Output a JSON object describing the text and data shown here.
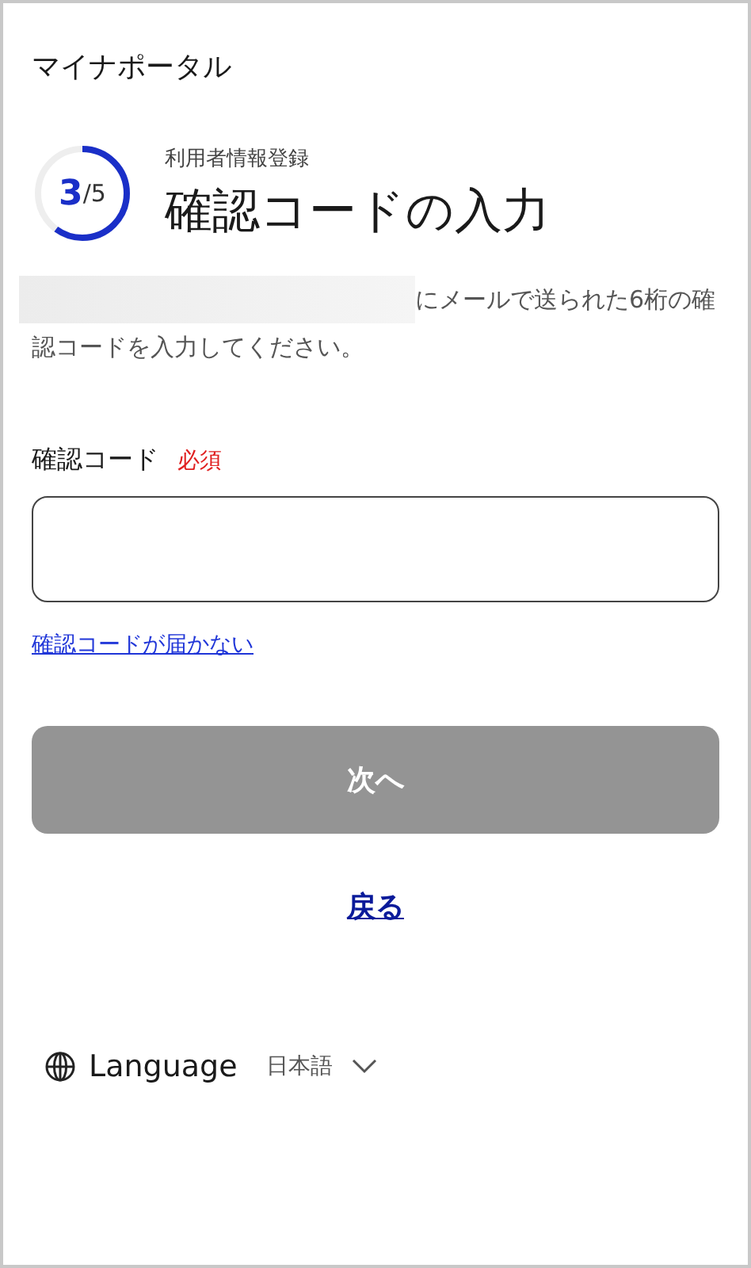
{
  "header": {
    "title": "マイナポータル"
  },
  "progress": {
    "current": "3",
    "total": "/5",
    "level": 0.6
  },
  "heading": {
    "subtitle": "利用者情報登録",
    "title": "確認コードの入力"
  },
  "instruction": {
    "redacted": true,
    "text": "にメールで送られた6桁の確認コードを入力してください。"
  },
  "field": {
    "label": "確認コード",
    "required": "必須"
  },
  "help_link": "確認コードが届かない",
  "next_button": {
    "label": "次へ",
    "disabled": true
  },
  "back_link": "戻る",
  "language": {
    "label": "Language",
    "value": "日本語"
  }
}
